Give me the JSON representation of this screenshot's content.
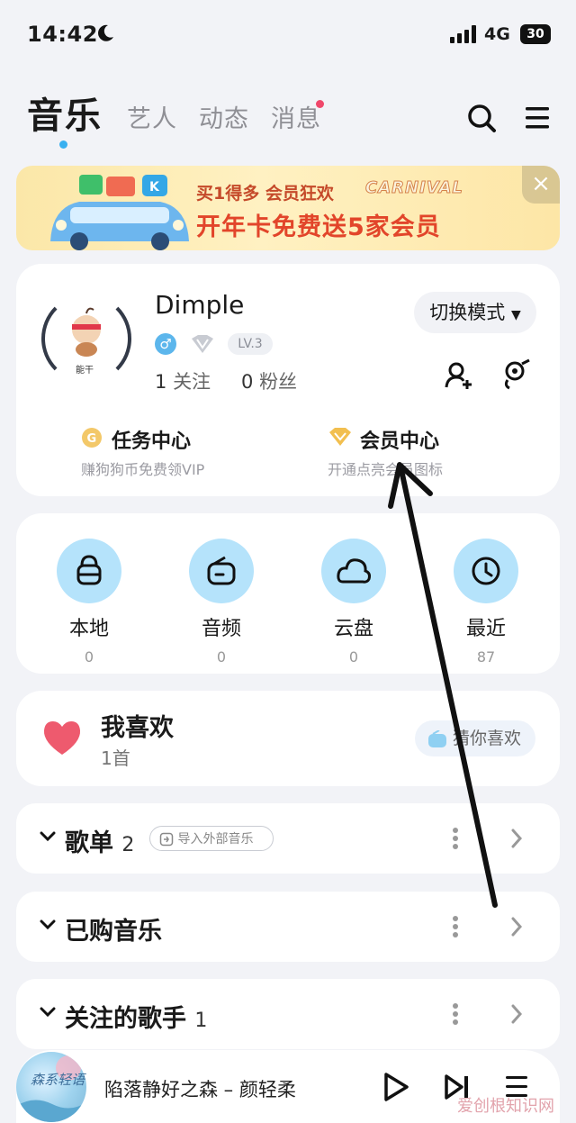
{
  "status_bar": {
    "time": "14:42",
    "network": "4G",
    "battery": "30"
  },
  "nav": {
    "tabs": [
      {
        "label": "音乐",
        "active": true
      },
      {
        "label": "艺人"
      },
      {
        "label": "动态"
      },
      {
        "label": "消息",
        "has_dot": true
      }
    ]
  },
  "banner": {
    "line1": "买1得多 会员狂欢",
    "carnival": "CARNIVAL",
    "line2": "开年卡免费送5家会员",
    "close": "×"
  },
  "profile": {
    "avatar_text": "能干",
    "username": "Dimple",
    "switch_mode": "切换模式",
    "level": "LV.3",
    "following_count": "1",
    "following_label": "关注",
    "fans_count": "0",
    "fans_label": "粉丝",
    "task_center": {
      "title": "任务中心",
      "subtitle": "赚狗狗币免费领VIP"
    },
    "vip_center": {
      "title": "会员中心",
      "subtitle": "开通点亮会员图标"
    }
  },
  "quick_access": [
    {
      "label": "本地",
      "count": "0",
      "icon": "lock-bag-icon"
    },
    {
      "label": "音频",
      "count": "0",
      "icon": "radio-icon"
    },
    {
      "label": "云盘",
      "count": "0",
      "icon": "cloud-icon"
    },
    {
      "label": "最近",
      "count": "87",
      "icon": "clock-icon"
    }
  ],
  "favorites": {
    "title": "我喜欢",
    "count": "1首",
    "guess": "猜你喜欢"
  },
  "sections": [
    {
      "title": "歌单",
      "count": "2",
      "import": "导入外部音乐"
    },
    {
      "title": "已购音乐",
      "count": ""
    },
    {
      "title": "关注的歌手",
      "count": "1"
    }
  ],
  "player": {
    "cover_text": "森系轻语",
    "now_playing": "陷落静好之森 – 颜轻柔"
  },
  "watermark": "爱创根知识网",
  "colors": {
    "accent": "#39b0f0",
    "quick_circle": "#b5e3fb",
    "heart": "#ee5a6e",
    "msg_dot": "#f0486b"
  }
}
